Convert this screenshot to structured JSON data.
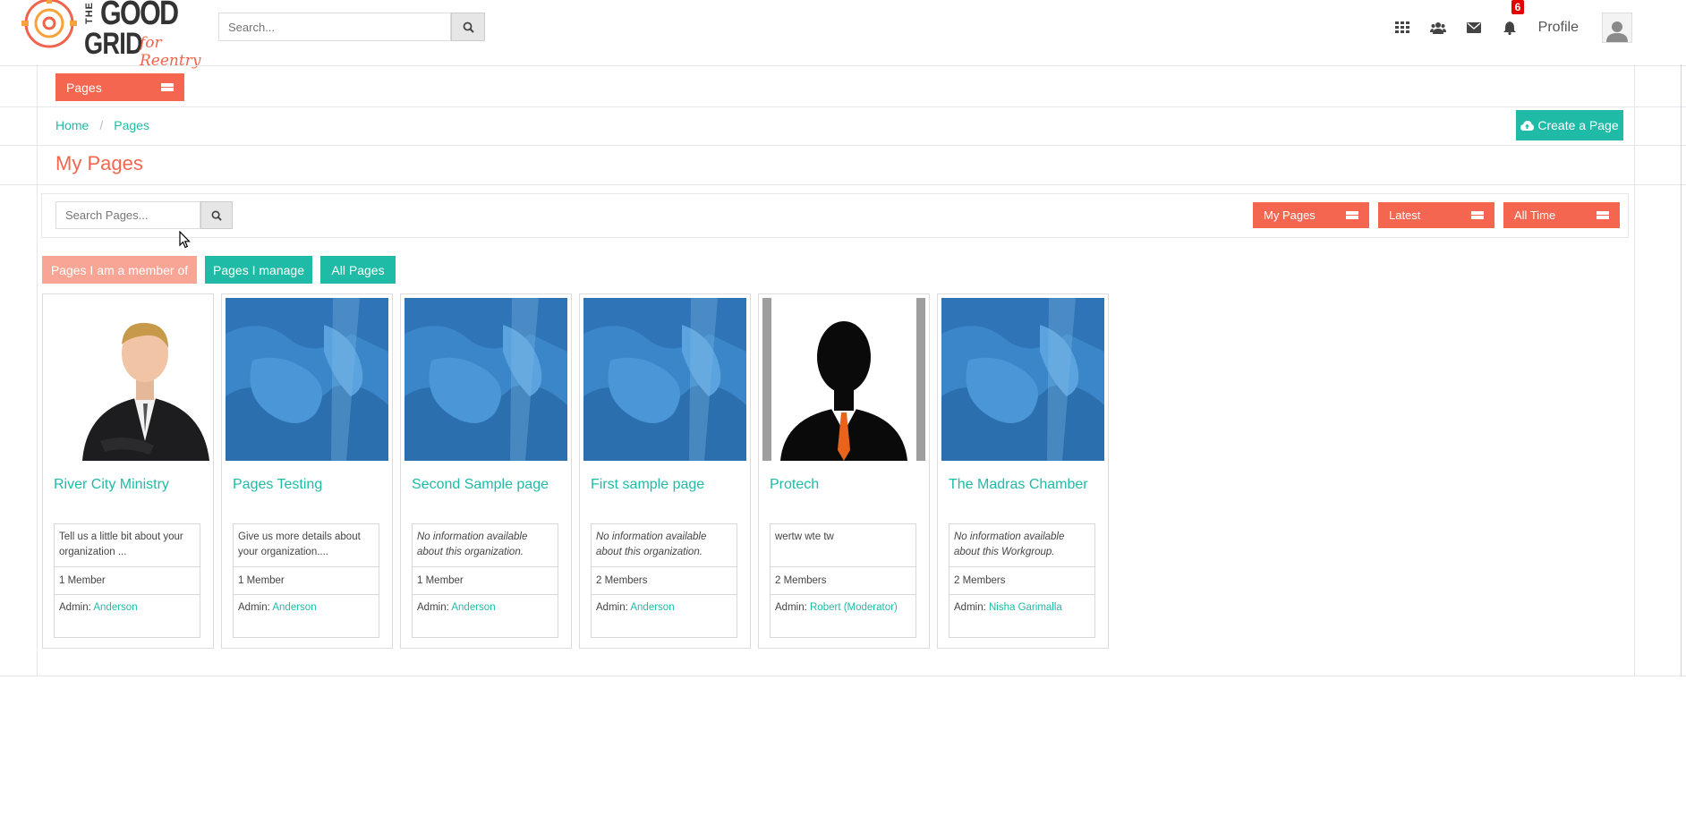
{
  "header": {
    "logo": {
      "line1": "THE",
      "line2": "GOOD",
      "line3": "GRID",
      "tagline": "for Reentry"
    },
    "search": {
      "placeholder": "Search..."
    },
    "nav_icons": [
      "apps-grid-icon",
      "users-icon",
      "envelope-icon",
      "bell-icon"
    ],
    "notification_count": "6",
    "profile_label": "Profile"
  },
  "pages_menu": {
    "label": "Pages"
  },
  "breadcrumb": {
    "home": "Home",
    "current": "Pages"
  },
  "create_button": {
    "label": "Create a Page"
  },
  "page_title": "My Pages",
  "filters": {
    "search_placeholder": "Search Pages...",
    "dropdowns": [
      "My Pages",
      "Latest",
      "All Time"
    ]
  },
  "tabs": {
    "member": "Pages I am a member of",
    "manage": "Pages I manage",
    "all": "All Pages"
  },
  "cards": [
    {
      "title": "River City Ministry",
      "description": "Tell us a little bit about your organization ...",
      "italic": false,
      "members": "1 Member",
      "admin_label": "Admin:",
      "admin": "Anderson",
      "image": "person-photo"
    },
    {
      "title": "Pages Testing",
      "description": "Give us more details about your organization....",
      "italic": false,
      "members": "1 Member",
      "admin_label": "Admin:",
      "admin": "Anderson",
      "image": "blue-pattern"
    },
    {
      "title": "Second Sample page",
      "description": "No information available about this organization.",
      "italic": true,
      "members": "1 Member",
      "admin_label": "Admin:",
      "admin": "Anderson",
      "image": "blue-pattern"
    },
    {
      "title": "First sample page",
      "description": "No information available about this organization.",
      "italic": true,
      "members": "2 Members",
      "admin_label": "Admin:",
      "admin": "Anderson",
      "image": "blue-pattern"
    },
    {
      "title": "Protech",
      "description": "wertw wte tw",
      "italic": false,
      "members": "2 Members",
      "admin_label": "Admin:",
      "admin": "Robert (Moderator)",
      "image": "silhouette"
    },
    {
      "title": "The Madras Chamber",
      "description": "No information available about this Workgroup.",
      "italic": true,
      "members": "2 Members",
      "admin_label": "Admin:",
      "admin": "Nisha Garimalla",
      "image": "blue-pattern"
    }
  ],
  "colors": {
    "accent": "#f4664f",
    "teal": "#1fbba6",
    "tab_active": "#f9a595",
    "badge": "#e40000"
  }
}
